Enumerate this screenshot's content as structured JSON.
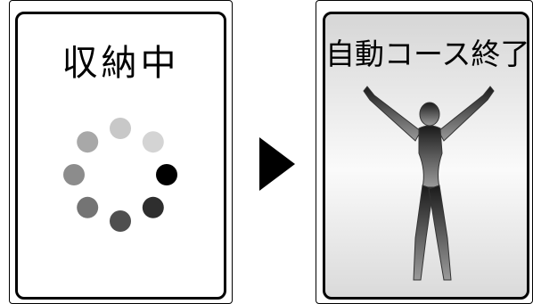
{
  "left_panel": {
    "title": "収納中",
    "spinner_dot_colors": [
      "#c8c8c8",
      "#d4d4d4",
      "#000000",
      "#2e2e2e",
      "#4f4f4f",
      "#747474",
      "#8c8c8c",
      "#a8a8a8"
    ]
  },
  "right_panel": {
    "title": "自動コース終了"
  },
  "arrow_color": "#000000",
  "icons": {
    "spinner": "loading-spinner-icon",
    "arrow": "play-arrow-icon",
    "figure": "stretching-person-icon"
  }
}
